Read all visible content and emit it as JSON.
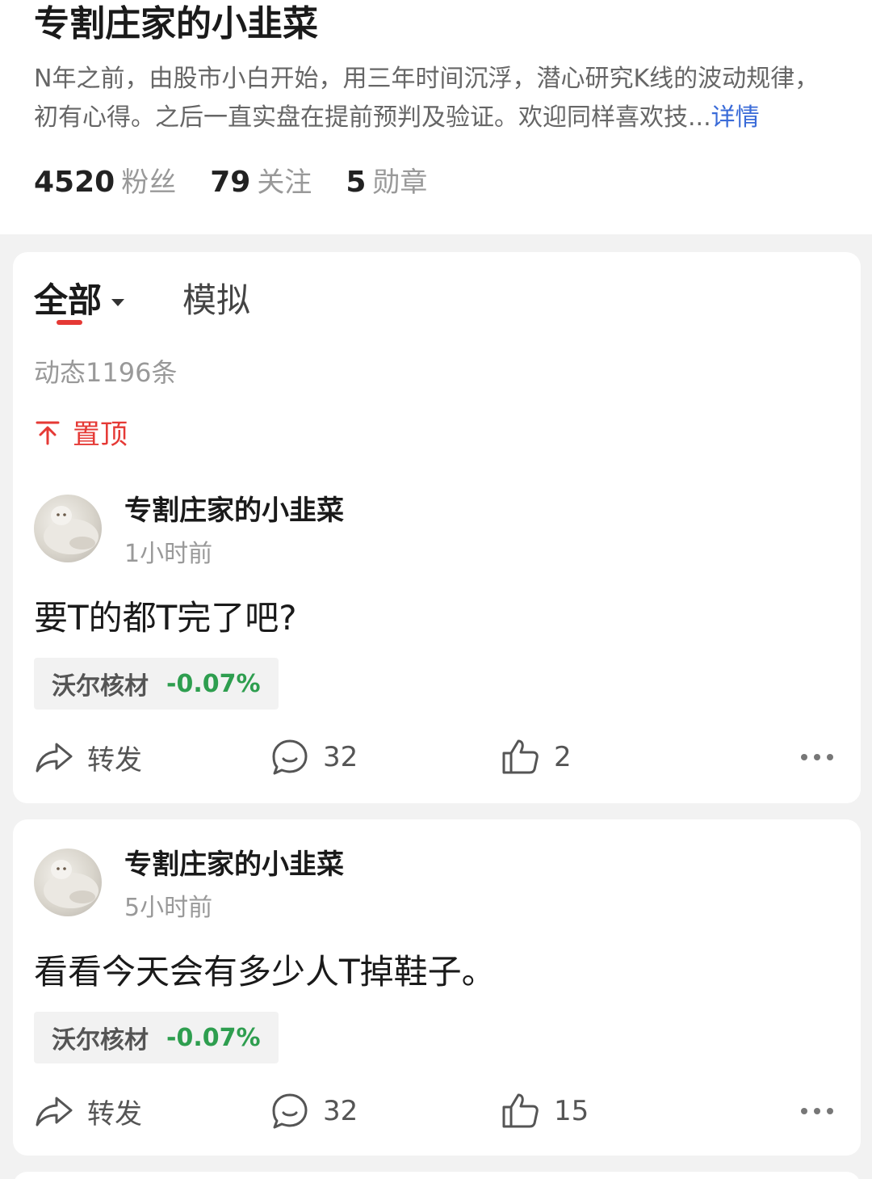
{
  "profile": {
    "name": "专割庄家的小韭菜",
    "bio": "N年之前，由股市小白开始，用三年时间沉浮，潜心研究K线的波动规律，初有心得。之后一直实盘在提前预判及验证。欢迎同样喜欢技...",
    "bio_more": "详情",
    "stats": {
      "fans_num": "4520",
      "fans_label": "粉丝",
      "follow_num": "79",
      "follow_label": "关注",
      "medal_num": "5",
      "medal_label": "勋章"
    }
  },
  "tabs": {
    "all": "全部",
    "sim": "模拟"
  },
  "feed_count": "动态1196条",
  "pinned_label": "置顶",
  "posts": [
    {
      "author": "专割庄家的小韭菜",
      "time": "1小时前",
      "content": "要T的都T完了吧?",
      "stock_name": "沃尔核材",
      "stock_change": "-0.07%",
      "share_label": "转发",
      "comments": "32",
      "likes": "2"
    },
    {
      "author": "专割庄家的小韭菜",
      "time": "5小时前",
      "content": "看看今天会有多少人T掉鞋子。",
      "stock_name": "沃尔核材",
      "stock_change": "-0.07%",
      "share_label": "转发",
      "comments": "32",
      "likes": "15"
    }
  ],
  "colors": {
    "accent_red": "#e53935",
    "down_green": "#2e9e4f",
    "link_blue": "#3a6bd8"
  },
  "icons": [
    "share-icon",
    "comment-icon",
    "thumbs-up-icon",
    "more-icon",
    "pin-icon",
    "caret-down-icon"
  ]
}
